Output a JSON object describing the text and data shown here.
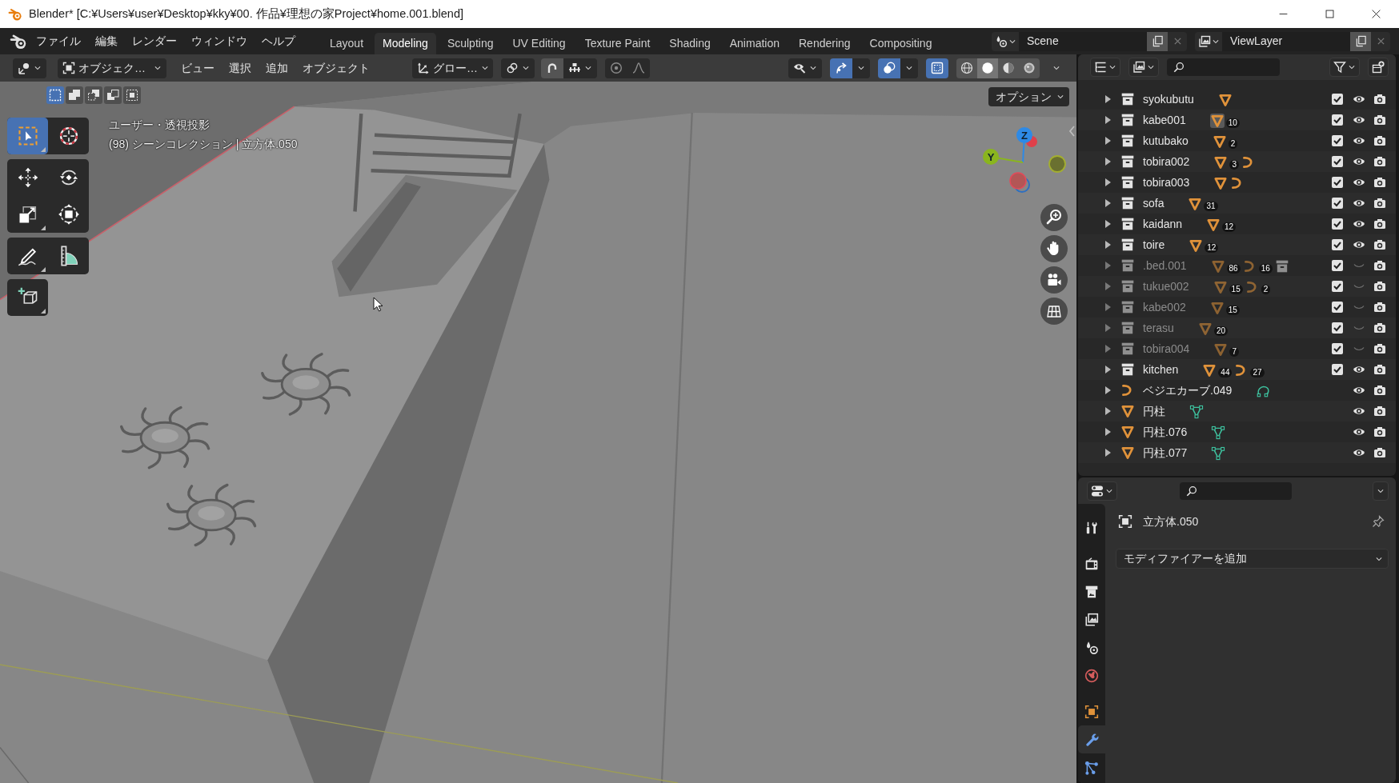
{
  "window": {
    "title": "Blender* [C:¥Users¥user¥Desktop¥kky¥00. 作品¥理想の家Project¥home.001.blend]"
  },
  "top_bar": {
    "menus": [
      "ファイル",
      "編集",
      "レンダー",
      "ウィンドウ",
      "ヘルプ"
    ],
    "workspaces": [
      {
        "label": "Layout",
        "selected": false
      },
      {
        "label": "Modeling",
        "selected": true
      },
      {
        "label": "Sculpting",
        "selected": false
      },
      {
        "label": "UV Editing",
        "selected": false
      },
      {
        "label": "Texture Paint",
        "selected": false
      },
      {
        "label": "Shading",
        "selected": false
      },
      {
        "label": "Animation",
        "selected": false
      },
      {
        "label": "Rendering",
        "selected": false
      },
      {
        "label": "Compositing",
        "selected": false
      }
    ],
    "scene": "Scene",
    "view_layer": "ViewLayer"
  },
  "viewport": {
    "header": {
      "mode": "オブジェク…",
      "menus": [
        "ビュー",
        "選択",
        "追加",
        "オブジェクト"
      ],
      "orientation": "グロー…",
      "gizmos_on": true,
      "overlays_on": true,
      "xray_on": true,
      "shading": [
        {
          "kind": "wireframe",
          "selected": false
        },
        {
          "kind": "solid",
          "selected": true
        },
        {
          "kind": "material",
          "selected": false
        },
        {
          "kind": "rendered",
          "selected": false
        }
      ]
    },
    "select_modes": [
      {
        "kind": "new",
        "selected": true
      },
      {
        "kind": "extend",
        "selected": false
      },
      {
        "kind": "subtract",
        "selected": false
      },
      {
        "kind": "invert",
        "selected": false
      },
      {
        "kind": "intersect",
        "selected": false
      }
    ],
    "options": "オプション",
    "view_name": "ユーザー・透視投影",
    "context": "(98) シーンコレクション | 立方体.050",
    "toolbar": [
      {
        "tools": [
          {
            "kind": "select_box",
            "selected": true,
            "submenu": true
          },
          {
            "kind": "cursor",
            "selected": false,
            "submenu": false
          }
        ]
      },
      {
        "tools": [
          {
            "kind": "move",
            "selected": false,
            "submenu": false
          },
          {
            "kind": "rotate",
            "selected": false,
            "submenu": false
          },
          {
            "kind": "scale",
            "selected": false,
            "submenu": true
          },
          {
            "kind": "transform",
            "selected": false,
            "submenu": false
          }
        ]
      },
      {
        "tools": [
          {
            "kind": "annotate",
            "selected": false,
            "submenu": true
          },
          {
            "kind": "measure",
            "selected": false,
            "submenu": false
          }
        ]
      },
      {
        "tools": [
          {
            "kind": "add_cube",
            "selected": false,
            "submenu": true
          }
        ]
      }
    ],
    "gizmo_axes": [
      {
        "label": "Z",
        "color": "#2e8ae6"
      },
      {
        "label": "Y",
        "color": "#8ab51e"
      }
    ]
  },
  "outliner": {
    "rows": [
      {
        "kind": "collection",
        "name": "syokubutu",
        "expanded": false,
        "checked": true,
        "visible": true,
        "contents": [
          {
            "kind": "mesh",
            "highlighted": false
          }
        ]
      },
      {
        "kind": "collection",
        "name": "kabe001",
        "expanded": false,
        "checked": true,
        "visible": true,
        "contents": [
          {
            "kind": "mesh",
            "count": "10",
            "highlighted": true
          }
        ]
      },
      {
        "kind": "collection",
        "name": "kutubako",
        "expanded": false,
        "checked": true,
        "visible": true,
        "contents": [
          {
            "kind": "mesh",
            "count": "2",
            "highlighted": false
          }
        ]
      },
      {
        "kind": "collection",
        "name": "tobira002",
        "expanded": false,
        "checked": true,
        "visible": true,
        "contents": [
          {
            "kind": "mesh",
            "count": "3",
            "highlighted": false
          },
          {
            "kind": "curve",
            "highlighted": false
          }
        ]
      },
      {
        "kind": "collection",
        "name": "tobira003",
        "expanded": false,
        "checked": true,
        "visible": true,
        "contents": [
          {
            "kind": "mesh",
            "highlighted": false
          },
          {
            "kind": "curve",
            "highlighted": false
          }
        ]
      },
      {
        "kind": "collection",
        "name": "sofa",
        "expanded": false,
        "checked": true,
        "visible": true,
        "contents": [
          {
            "kind": "mesh",
            "count": "31",
            "highlighted": false
          }
        ]
      },
      {
        "kind": "collection",
        "name": "kaidann",
        "expanded": false,
        "checked": true,
        "visible": true,
        "contents": [
          {
            "kind": "mesh",
            "count": "12",
            "highlighted": false
          }
        ]
      },
      {
        "kind": "collection",
        "name": "toire",
        "expanded": false,
        "checked": true,
        "visible": true,
        "contents": [
          {
            "kind": "mesh",
            "count": "12",
            "highlighted": false
          }
        ]
      },
      {
        "kind": "collection",
        "name": ".bed.001",
        "expanded": false,
        "checked": true,
        "visible": false,
        "contents": [
          {
            "kind": "mesh",
            "count": "86",
            "highlighted": false
          },
          {
            "kind": "curve",
            "count": "16",
            "highlighted": false
          },
          {
            "kind": "collection",
            "highlighted": false
          }
        ]
      },
      {
        "kind": "collection",
        "name": "tukue002",
        "expanded": false,
        "checked": true,
        "visible": false,
        "contents": [
          {
            "kind": "mesh",
            "count": "15",
            "highlighted": false
          },
          {
            "kind": "curve",
            "count": "2",
            "highlighted": false
          }
        ]
      },
      {
        "kind": "collection",
        "name": "kabe002",
        "expanded": false,
        "checked": true,
        "visible": false,
        "contents": [
          {
            "kind": "mesh",
            "count": "15",
            "highlighted": false
          }
        ]
      },
      {
        "kind": "collection",
        "name": "terasu",
        "expanded": false,
        "checked": true,
        "visible": false,
        "contents": [
          {
            "kind": "mesh",
            "count": "20",
            "highlighted": false
          }
        ]
      },
      {
        "kind": "collection",
        "name": "tobira004",
        "expanded": false,
        "checked": true,
        "visible": false,
        "contents": [
          {
            "kind": "mesh",
            "count": "7",
            "highlighted": false
          }
        ]
      },
      {
        "kind": "collection",
        "name": "kitchen",
        "expanded": false,
        "checked": true,
        "visible": true,
        "contents": [
          {
            "kind": "mesh",
            "count": "44",
            "highlighted": false
          },
          {
            "kind": "curve",
            "count": "27",
            "highlighted": false
          }
        ]
      },
      {
        "kind": "curve",
        "name": "ベジエカーブ.049",
        "expanded": false,
        "visible": true,
        "contents": [
          {
            "kind": "curve_data",
            "highlighted": false
          }
        ]
      },
      {
        "kind": "mesh",
        "name": "円柱",
        "expanded": false,
        "visible": true,
        "contents": [
          {
            "kind": "mesh_data",
            "highlighted": false
          }
        ]
      },
      {
        "kind": "mesh",
        "name": "円柱.076",
        "expanded": false,
        "visible": true,
        "contents": [
          {
            "kind": "mesh_data",
            "highlighted": false
          }
        ]
      },
      {
        "kind": "mesh",
        "name": "円柱.077",
        "expanded": false,
        "visible": true,
        "contents": [
          {
            "kind": "mesh_data",
            "highlighted": false
          }
        ]
      }
    ]
  },
  "properties": {
    "tab_groups": [
      [
        {
          "kind": "tool",
          "selected": false
        }
      ],
      [
        {
          "kind": "render",
          "selected": false
        },
        {
          "kind": "output",
          "selected": false
        },
        {
          "kind": "view_layer",
          "selected": false
        },
        {
          "kind": "scene",
          "selected": false
        },
        {
          "kind": "world",
          "selected": false
        }
      ],
      [
        {
          "kind": "object",
          "selected": false
        },
        {
          "kind": "modifier",
          "selected": true
        },
        {
          "kind": "data",
          "selected": false
        }
      ]
    ],
    "object_name": "立方体.050",
    "add_modifier": "モディファイアーを追加"
  }
}
